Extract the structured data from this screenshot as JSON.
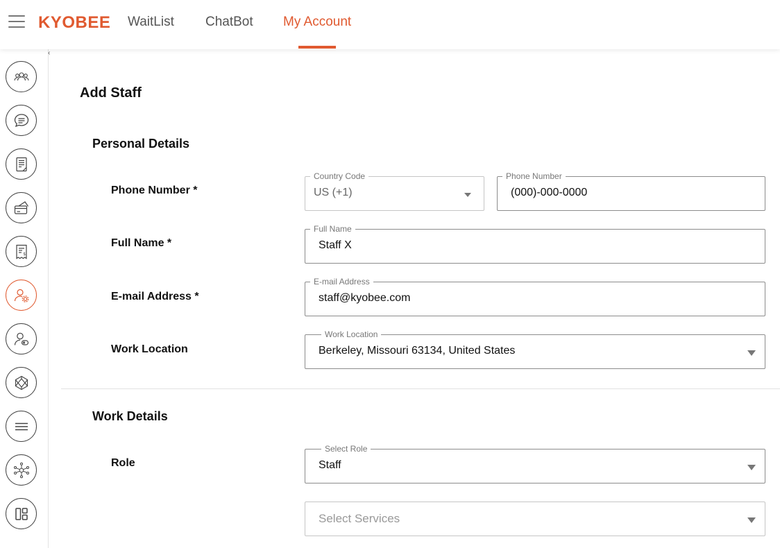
{
  "header": {
    "logo": "KYOBEE",
    "nav": [
      {
        "label": "WaitList",
        "active": false
      },
      {
        "label": "ChatBot",
        "active": false
      },
      {
        "label": "My Account",
        "active": true
      }
    ],
    "accent_color": "#e05a30"
  },
  "sidebar": {
    "icons": [
      "group-icon",
      "chat-icon",
      "notes-icon",
      "payment-card-icon",
      "receipt-icon",
      "user-settings-icon",
      "user-key-icon",
      "network-sphere-icon",
      "menu-lines-icon",
      "hub-network-icon",
      "layout-icon"
    ],
    "active_index": 5
  },
  "page": {
    "title": "Add Staff",
    "personal_section": "Personal Details",
    "work_section": "Work Details"
  },
  "form": {
    "phone_label": "Phone Number *",
    "country_code_legend": "Country Code",
    "country_code_value": "US (+1)",
    "phone_legend": "Phone Number",
    "phone_value": "(000)-000-0000",
    "full_name_label": "Full Name *",
    "full_name_legend": "Full Name",
    "full_name_value": "Staff X",
    "email_label": "E-mail Address *",
    "email_legend": "E-mail Address",
    "email_value": "staff@kyobee.com",
    "work_location_label": "Work Location",
    "work_location_legend": "Work Location",
    "work_location_value": "Berkeley, Missouri 63134, United States",
    "role_label": "Role",
    "role_legend": "Select Role",
    "role_value": "Staff",
    "services_placeholder": "Select Services"
  }
}
